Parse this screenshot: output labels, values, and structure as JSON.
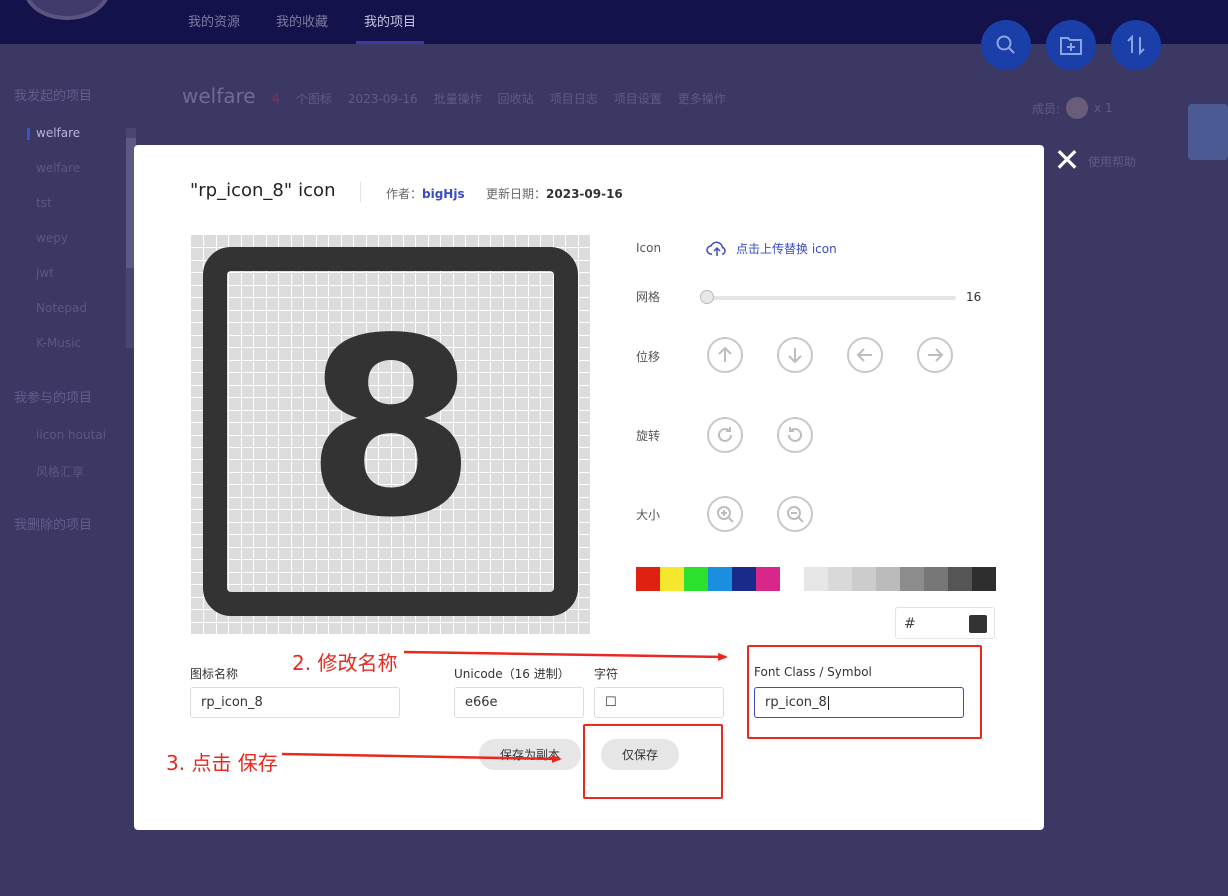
{
  "topnav": {
    "items": [
      "我的资源",
      "我的收藏",
      "我的项目"
    ],
    "active_index": 2
  },
  "toolbar": {
    "search_icon": "search-icon",
    "add_folder_icon": "add-folder-icon",
    "sort_icon": "sort-icon"
  },
  "sidebar": {
    "group_created": "我发起的项目",
    "created_items": [
      "welfare",
      "welfare",
      "tst",
      "wepy",
      "jwt",
      "Notepad",
      "K-Music"
    ],
    "active_item": 0,
    "group_joined": "我参与的项目",
    "joined_items": [
      "iicon houtai",
      "风格汇享"
    ],
    "group_deleted": "我删除的项目"
  },
  "project": {
    "name": "welfare",
    "icon_count": "4",
    "icon_count_label": "个图标",
    "date": "2023-09-16",
    "actions": [
      "批量操作",
      "回收站",
      "项目日志",
      "项目设置",
      "更多操作"
    ],
    "members_label": "成员:",
    "members_count": "x 1",
    "help_label": "使用帮助"
  },
  "modal": {
    "icon_name_quoted": "\"rp_icon_8\"",
    "icon_suffix": "icon",
    "author_label": "作者：",
    "author": "bigHjs",
    "date_label": "更新日期：",
    "date": "2023-09-16",
    "preview_glyph": "8",
    "controls": {
      "icon_label": "Icon",
      "upload_label": "点击上传替换 icon",
      "grid_label": "网格",
      "grid_value": "16",
      "grid_slider_level": 0,
      "move_label": "位移",
      "rotate_label": "旋转",
      "size_label": "大小"
    },
    "colors": [
      "#e02010",
      "#f5e62e",
      "#2ee02e",
      "#1a8fe0",
      "#1a2a8a",
      "#d8268a"
    ],
    "grays": [
      "#e6e6e6",
      "#d9d9d9",
      "#cccccc",
      "#bbbbbb",
      "#8c8c8c",
      "#777777",
      "#555555",
      "#2e2e2e"
    ],
    "hex_prefix": "#",
    "current_color": "#333333",
    "fields": {
      "name_label": "图标名称",
      "name_value": "rp_icon_8",
      "unicode_label": "Unicode（16 进制）",
      "unicode_value": "e66e",
      "char_label": "字符",
      "char_value": "☐",
      "fontclass_label": "Font Class / Symbol",
      "fontclass_value": "rp_icon_8"
    },
    "buttons": {
      "save_copy": "保存为副本",
      "save_only": "仅保存"
    },
    "close_glyph": "✕"
  },
  "annotations": {
    "step2": "2. 修改名称",
    "step3": "3. 点击 保存"
  }
}
